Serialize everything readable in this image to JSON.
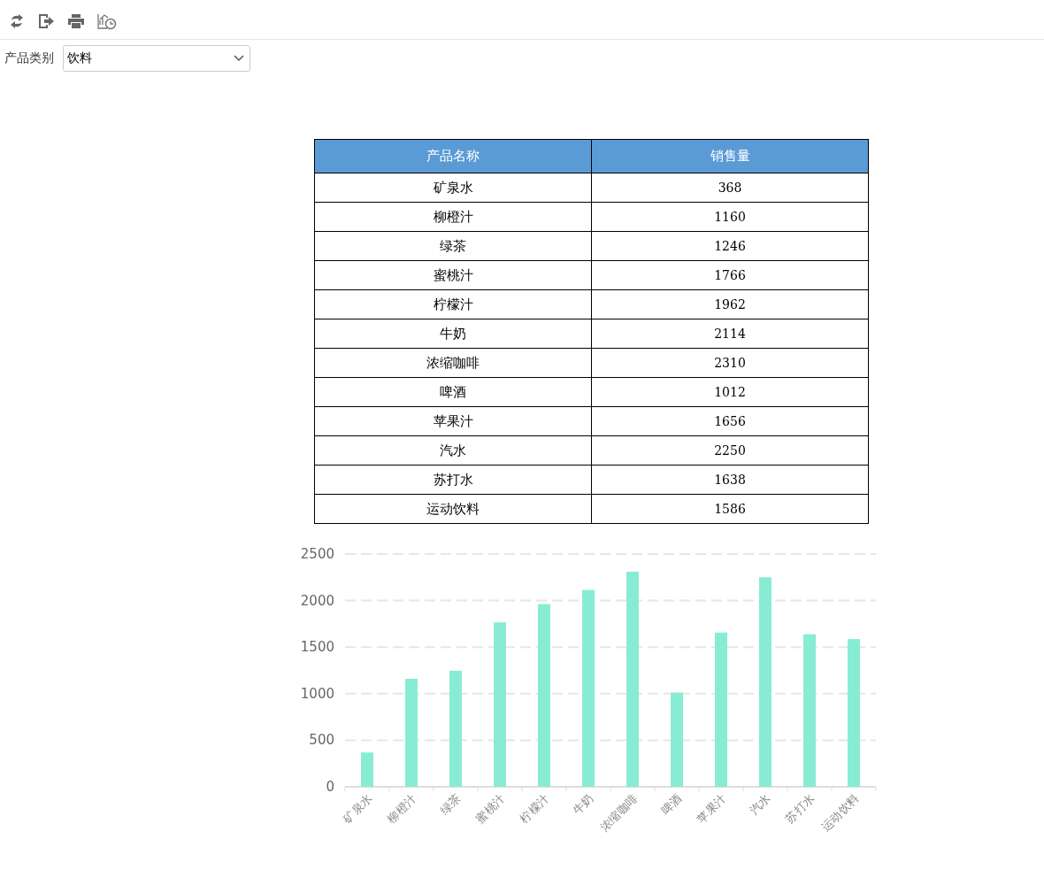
{
  "toolbar": {
    "tools": [
      {
        "kind": "refresh"
      },
      {
        "kind": "export"
      },
      {
        "kind": "print"
      },
      {
        "kind": "schedule"
      }
    ]
  },
  "filter": {
    "label": "产品类别",
    "value": "饮料"
  },
  "table": {
    "columns": [
      "产品名称",
      "销售量"
    ],
    "rows": [
      [
        "矿泉水",
        "368"
      ],
      [
        "柳橙汁",
        "1160"
      ],
      [
        "绿茶",
        "1246"
      ],
      [
        "蜜桃汁",
        "1766"
      ],
      [
        "柠檬汁",
        "1962"
      ],
      [
        "牛奶",
        "2114"
      ],
      [
        "浓缩咖啡",
        "2310"
      ],
      [
        "啤酒",
        "1012"
      ],
      [
        "苹果汁",
        "1656"
      ],
      [
        "汽水",
        "2250"
      ],
      [
        "苏打水",
        "1638"
      ],
      [
        "运动饮料",
        "1586"
      ]
    ]
  },
  "chart_data": {
    "type": "bar",
    "categories": [
      "矿泉水",
      "柳橙汁",
      "绿茶",
      "蜜桃汁",
      "柠檬汁",
      "牛奶",
      "浓缩咖啡",
      "啤酒",
      "苹果汁",
      "汽水",
      "苏打水",
      "运动饮料"
    ],
    "values": [
      368,
      1160,
      1246,
      1766,
      1962,
      2114,
      2310,
      1012,
      1656,
      2250,
      1638,
      1586
    ],
    "ylim": [
      0,
      2500
    ],
    "yticks": [
      0,
      500,
      1000,
      1500,
      2000,
      2500
    ],
    "grid": true
  }
}
